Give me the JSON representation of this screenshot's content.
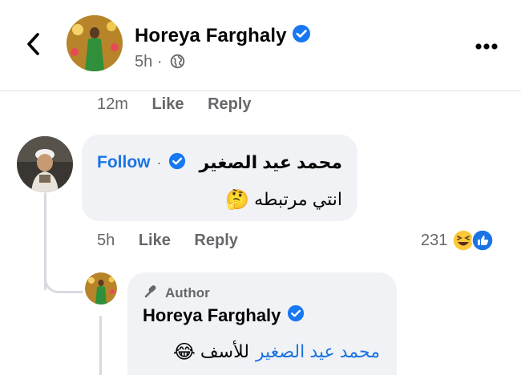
{
  "header": {
    "back_icon": "chevron-left-icon",
    "name": "Horeya Farghaly",
    "time": "5h",
    "separator": "·",
    "audience_icon": "globe-icon",
    "more_icon": "more-horizontal-icon"
  },
  "prev_comment_actions": {
    "time": "12m",
    "like": "Like",
    "reply": "Reply"
  },
  "comment": {
    "author": "محمد عيد الصغير",
    "follow": "Follow",
    "separator": "·",
    "text": "انتي مرتبطه",
    "emoji": "🤔",
    "actions": {
      "time": "5h",
      "like": "Like",
      "reply": "Reply"
    },
    "reactions": {
      "count": "231",
      "icons": [
        "haha-reaction-icon",
        "like-reaction-icon"
      ]
    }
  },
  "reply": {
    "badge_label": "Author",
    "badge_icon": "microphone-icon",
    "name": "Horeya Farghaly",
    "mention": "محمد عيد الصغير",
    "text": "للأسف",
    "emoji": "😂"
  },
  "colors": {
    "accent": "#1b74e4",
    "verified": "#1877f2",
    "muted": "#65676b",
    "bubble": "#f0f2f5"
  }
}
